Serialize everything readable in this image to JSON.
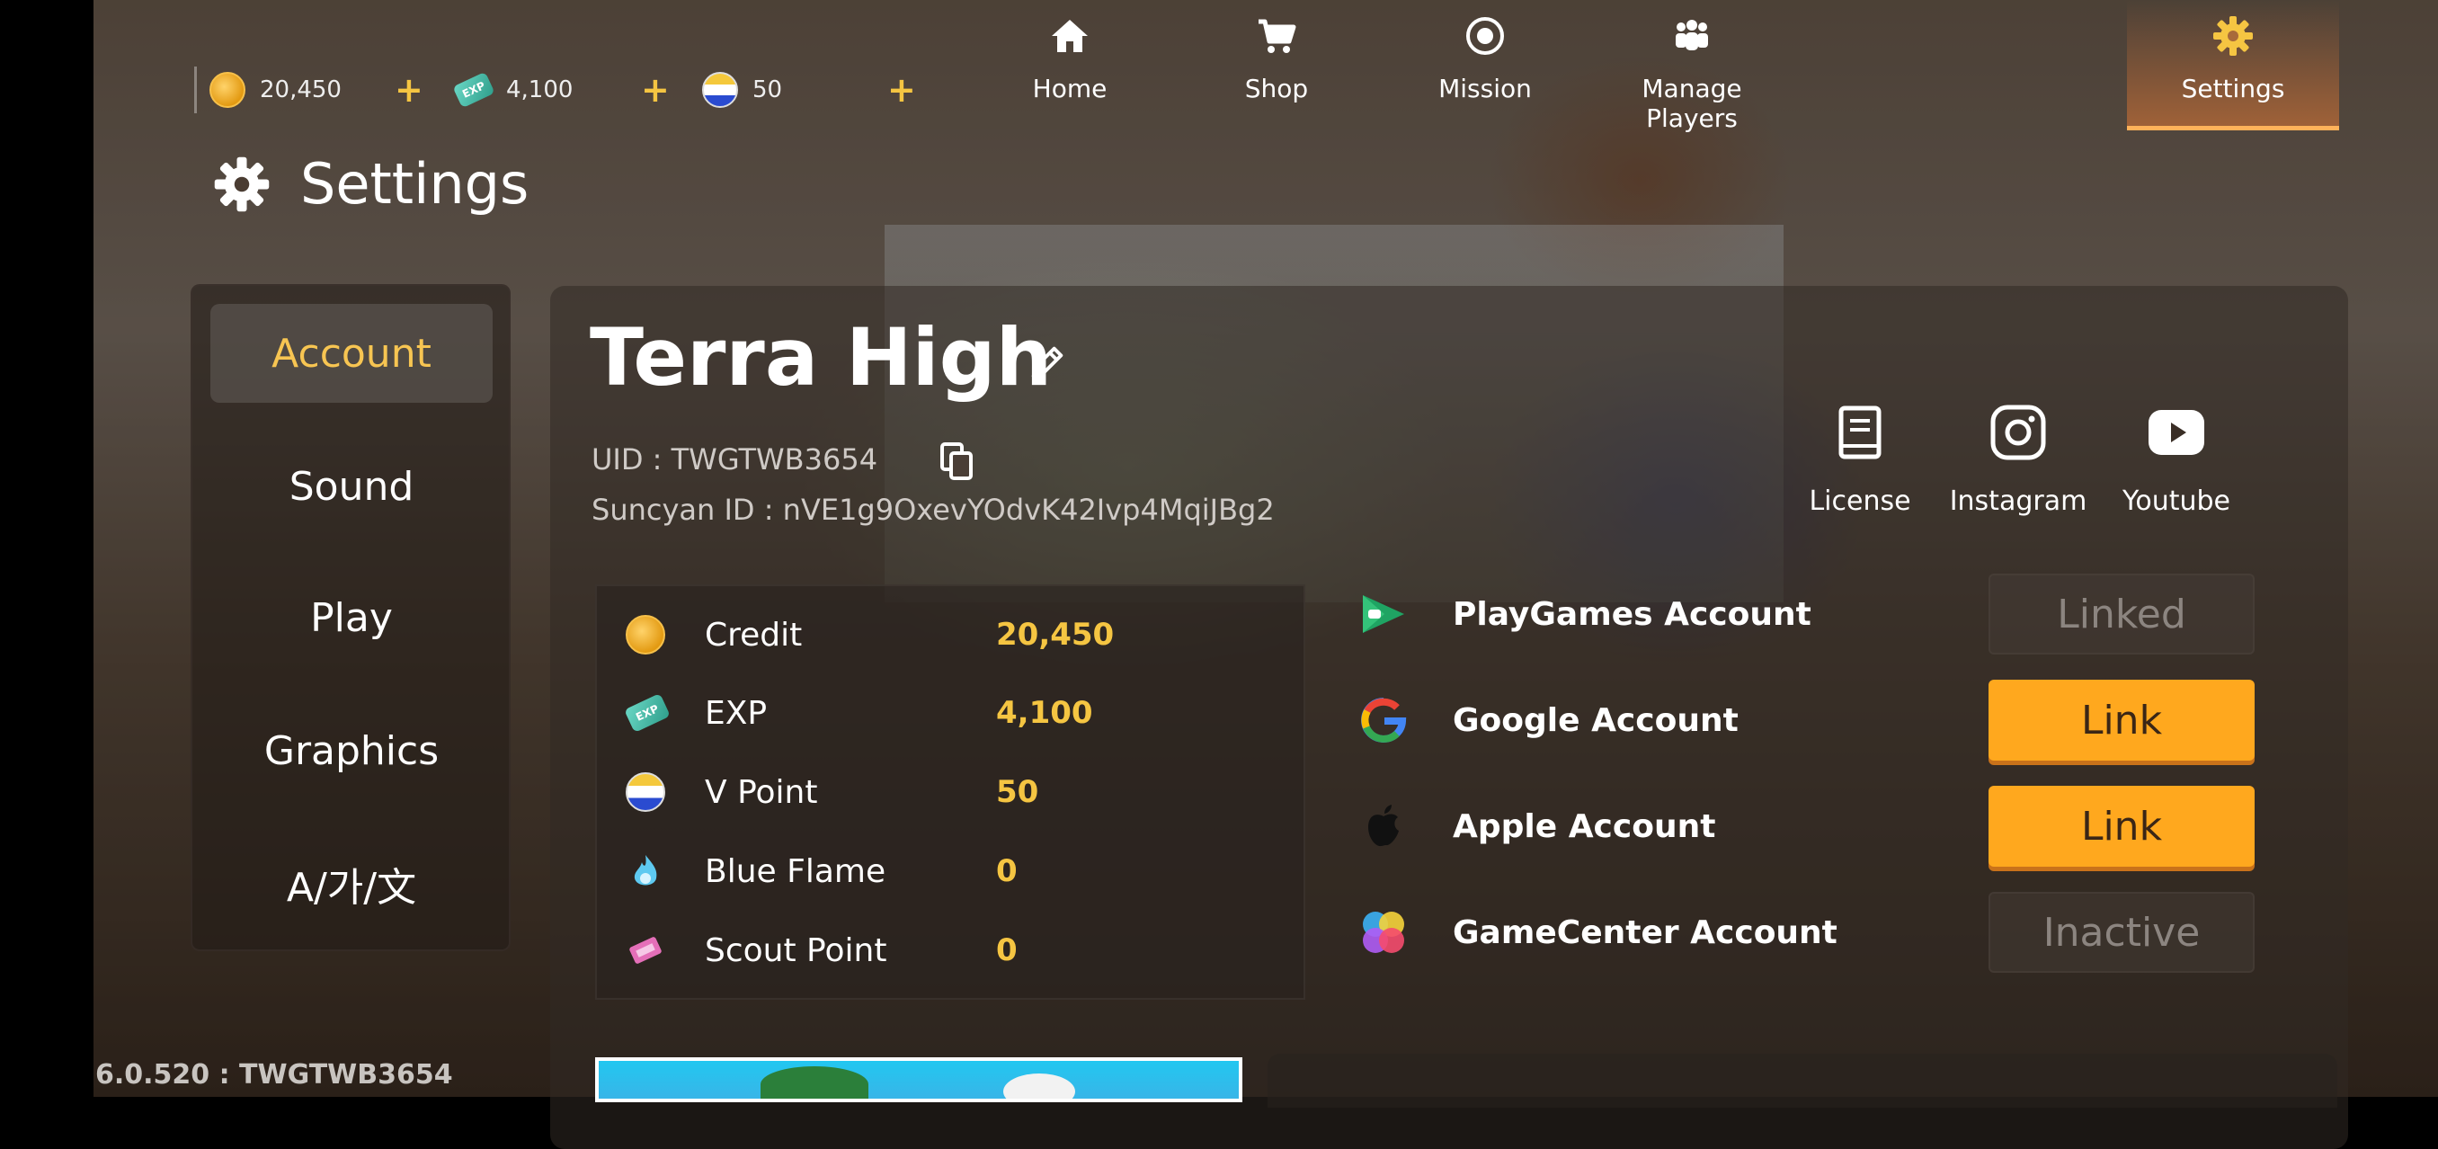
{
  "currency_bar": {
    "credit": "20,450",
    "exp": "4,100",
    "exp_icon_text": "EXP",
    "vpoint": "50",
    "plus": "+"
  },
  "nav": {
    "home": "Home",
    "shop": "Shop",
    "mission": "Mission",
    "manage_players": "Manage Players",
    "settings": "Settings"
  },
  "page_title": "Settings",
  "tabs": {
    "account": "Account",
    "sound": "Sound",
    "play": "Play",
    "graphics": "Graphics",
    "language": "A/가/文"
  },
  "profile": {
    "team_name": "Terra High",
    "uid": "UID : TWGTWB3654",
    "suncyan_id": "Suncyan ID : nVE1g9OxevYOdvK42Ivp4MqiJBg2"
  },
  "social": {
    "license": "License",
    "instagram": "Instagram",
    "youtube": "Youtube"
  },
  "currencies": [
    {
      "name": "Credit",
      "value": "20,450"
    },
    {
      "name": "EXP",
      "value": "4,100"
    },
    {
      "name": "V Point",
      "value": "50"
    },
    {
      "name": "Blue Flame",
      "value": "0"
    },
    {
      "name": "Scout Point",
      "value": "0"
    }
  ],
  "accounts": [
    {
      "name": "PlayGames Account",
      "button": "Linked"
    },
    {
      "name": "Google Account",
      "button": "Link"
    },
    {
      "name": "Apple Account",
      "button": "Link"
    },
    {
      "name": "GameCenter Account",
      "button": "Inactive"
    }
  ],
  "version": "6.0.520 : TWGTWB3654",
  "colors": {
    "accent": "#f5c542",
    "link_button": "#ffa81e",
    "nav_active": "#ffb25a"
  }
}
